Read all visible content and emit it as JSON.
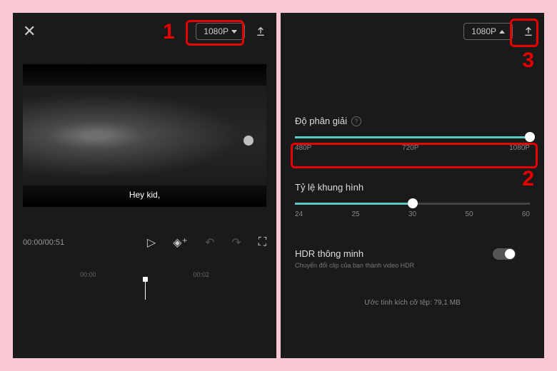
{
  "left": {
    "resolution": "1080P",
    "caption": "Hey kid,",
    "current_time": "00:00",
    "duration": "00:51",
    "timeline_t1": "00:00",
    "timeline_t2": "00:02"
  },
  "right": {
    "resolution": "1080P",
    "res_title": "Độ phân giải",
    "res_480": "480P",
    "res_720": "720P",
    "res_1080": "1080P",
    "fps_title": "Tỷ lệ khung hình",
    "fps_24": "24",
    "fps_25": "25",
    "fps_30": "30",
    "fps_50": "50",
    "fps_60": "60",
    "hdr_title": "HDR thông minh",
    "hdr_sub": "Chuyển đổi clip của bạn thành video HDR",
    "estimate": "Ước tính kích cỡ tệp: 79,1 MB"
  },
  "annot": {
    "n1": "1",
    "n2": "2",
    "n3": "3"
  }
}
